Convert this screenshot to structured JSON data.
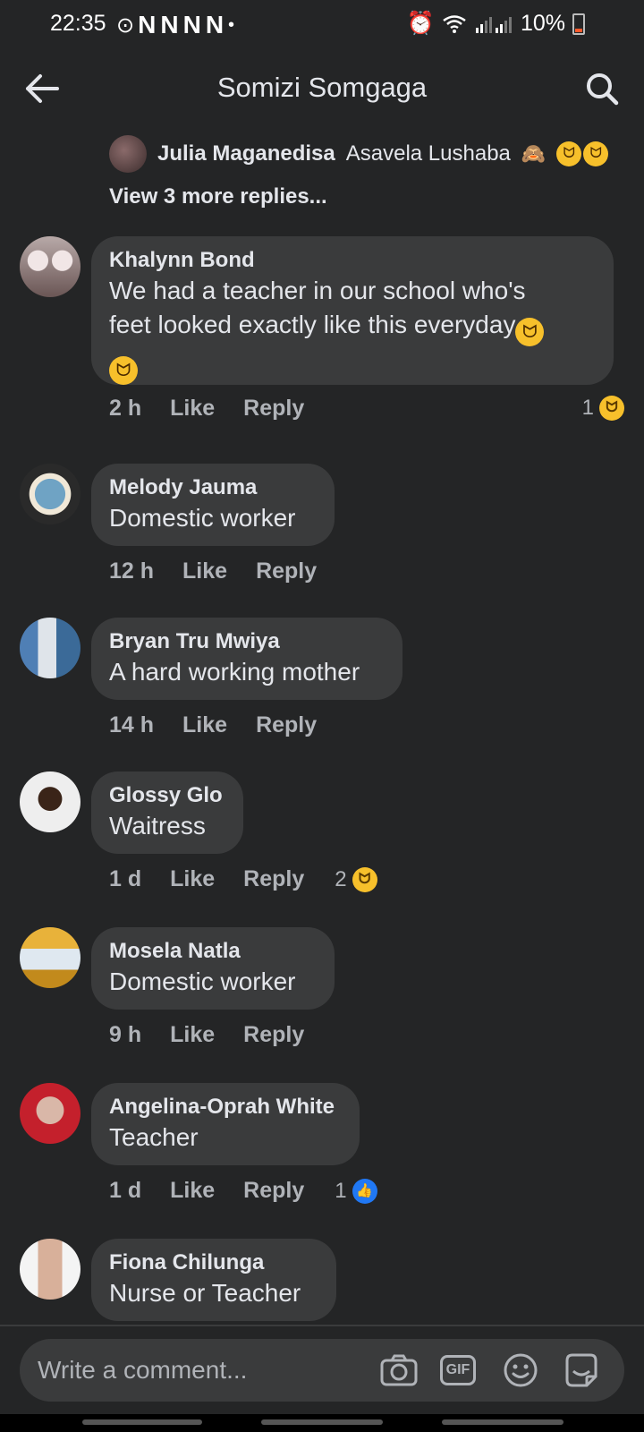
{
  "status_bar": {
    "time": "22:35",
    "notif_letters": [
      "N",
      "N",
      "N",
      "N"
    ],
    "battery": "10%"
  },
  "header": {
    "title": "Somizi Somgaga"
  },
  "thread": {
    "reply": {
      "name": "Julia Maganedisa",
      "text": "Asavela Lushaba"
    },
    "view_more": "View 3 more replies..."
  },
  "comments": [
    {
      "name": "Khalynn Bond",
      "text_line1": "We had a teacher in our school who's",
      "text_line2": "feet looked exactly like this everyday",
      "time": "2 h",
      "like": "Like",
      "reply": "Reply",
      "reaction_count": "1",
      "reaction": "laugh-emoji"
    },
    {
      "name": "Melody Jauma",
      "text": "Domestic worker",
      "time": "12 h",
      "like": "Like",
      "reply": "Reply"
    },
    {
      "name": "Bryan Tru Mwiya",
      "text": "A hard working mother",
      "time": "14 h",
      "like": "Like",
      "reply": "Reply"
    },
    {
      "name": "Glossy Glo",
      "text": "Waitress",
      "time": "1 d",
      "like": "Like",
      "reply": "Reply",
      "reaction_count": "2",
      "reaction": "laugh-emoji"
    },
    {
      "name": "Mosela Natla",
      "text": "Domestic worker",
      "time": "9 h",
      "like": "Like",
      "reply": "Reply"
    },
    {
      "name": "Angelina-Oprah White",
      "text": "Teacher",
      "time": "1 d",
      "like": "Like",
      "reply": "Reply",
      "reaction_count": "1",
      "reaction": "like-emoji"
    },
    {
      "name": "Fiona Chilunga",
      "text": "Nurse or Teacher"
    }
  ],
  "composer": {
    "placeholder": "Write a comment...",
    "gif_label": "GIF"
  },
  "colors": {
    "background": "#242526",
    "bubble": "#3a3b3c",
    "text": "#e4e6eb",
    "muted": "#b0b3b8",
    "like_blue": "#2078f4",
    "emoji_yellow": "#f7c02b"
  }
}
